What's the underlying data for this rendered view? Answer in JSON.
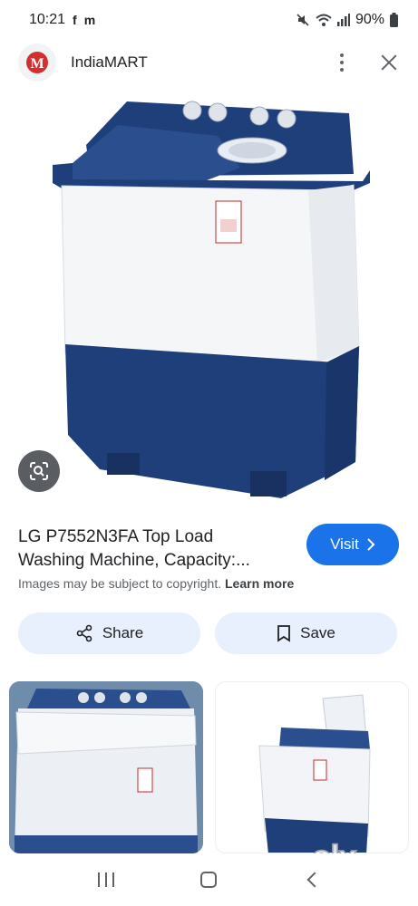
{
  "status_bar": {
    "time": "10:21",
    "left_glyphs": [
      "f",
      "m"
    ],
    "battery": "90%",
    "icons": [
      "mute-icon",
      "wifi-icon",
      "signal-icon",
      "battery-icon"
    ]
  },
  "header": {
    "site_name": "IndiaMART",
    "logo_text": "M"
  },
  "product": {
    "title_line1": "LG P7552N3FA Top Load",
    "title_line2": "Washing Machine, Capacity:...",
    "visit_label": "Visit",
    "copyright_text": "Images may be subject to copyright.",
    "learn_more": "Learn more"
  },
  "actions": {
    "share_label": "Share",
    "save_label": "Save"
  },
  "watermark": {
    "text": "olx"
  },
  "colors": {
    "accent": "#1a73e8",
    "pill_bg": "#e8f0fe",
    "machine_blue": "#1f3f7a"
  }
}
